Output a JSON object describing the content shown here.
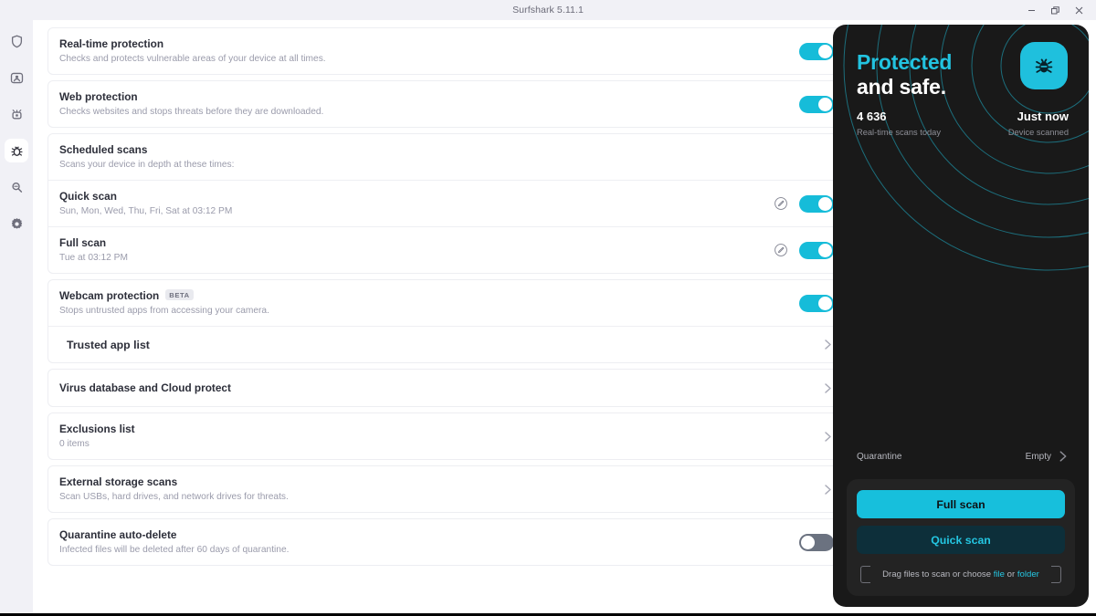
{
  "window": {
    "title": "Surfshark 5.11.1",
    "controls": [
      {
        "name": "minimize",
        "glyph": "minimize-icon"
      },
      {
        "name": "restore",
        "glyph": "restore-icon"
      },
      {
        "name": "close",
        "glyph": "close-icon"
      }
    ]
  },
  "sidebar": {
    "items": [
      {
        "name": "vpn",
        "icon": "shield-icon",
        "active": false
      },
      {
        "name": "alternative-id",
        "icon": "person-card-icon",
        "active": false
      },
      {
        "name": "alert",
        "icon": "alert-icon",
        "active": false
      },
      {
        "name": "antivirus",
        "icon": "bug-icon",
        "active": true
      },
      {
        "name": "search",
        "icon": "magnifier-icon",
        "active": false
      },
      {
        "name": "settings",
        "icon": "gear-icon",
        "active": false
      }
    ]
  },
  "main": {
    "realtime": {
      "title": "Real-time protection",
      "subtitle": "Checks and protects vulnerable areas of your device at all times.",
      "toggle": "on"
    },
    "web": {
      "title": "Web protection",
      "subtitle": "Checks websites and stops threats before they are downloaded.",
      "toggle": "on"
    },
    "scheduled": {
      "title": "Scheduled scans",
      "subtitle": "Scans your device in depth at these times:",
      "entries": [
        {
          "title": "Quick scan",
          "subtitle": "Sun, Mon, Wed, Thu, Fri, Sat at 03:12 PM",
          "edit_icon": "edit-pencil-icon",
          "toggle": "on"
        },
        {
          "title": "Full scan",
          "subtitle": "Tue at 03:12 PM",
          "edit_icon": "edit-pencil-icon",
          "toggle": "on"
        }
      ]
    },
    "webcam": {
      "title": "Webcam protection",
      "badge": "BETA",
      "subtitle": "Stops untrusted apps from accessing your camera.",
      "toggle": "on",
      "trusted_app_list": "Trusted app list"
    },
    "virus_db": {
      "title": "Virus database and Cloud protect"
    },
    "exclusions": {
      "title": "Exclusions list",
      "subtitle": "0 items"
    },
    "external": {
      "title": "External storage scans",
      "subtitle": "Scan USBs, hard drives, and network drives for threats."
    },
    "quarantine_auto": {
      "title": "Quarantine auto-delete",
      "subtitle": "Infected files will be deleted after 60 days of quarantine.",
      "toggle": "off"
    }
  },
  "status_panel": {
    "headline_line1": "Protected",
    "headline_line2": "and safe.",
    "badge_icon": "bug-icon",
    "stat_left": {
      "value": "4 636",
      "label": "Real-time scans today"
    },
    "stat_right": {
      "value": "Just now",
      "label": "Device scanned"
    },
    "quarantine": {
      "label": "Quarantine",
      "value": "Empty",
      "chevron": "chevron-right-icon"
    },
    "buttons": {
      "full_scan": "Full scan",
      "quick_scan": "Quick scan"
    },
    "dropzone": {
      "prefix": "Drag files to scan or choose ",
      "link_file": "file",
      "middle": " or ",
      "link_folder": "folder"
    }
  },
  "colors": {
    "accent_cyan": "#17bfdc",
    "accent_cyan_text": "#22c3e0",
    "panel_bg": "#191919",
    "scanbox_bg": "#232323",
    "quick_scan_bg": "#0d2f3a",
    "toggle_on": "#16bcd9",
    "toggle_off": "#6b7280",
    "rail_bg": "#f1f1f6",
    "card_border": "#edeef2",
    "title_text": "#2d2f3a",
    "sub_text": "#9a9bab"
  }
}
